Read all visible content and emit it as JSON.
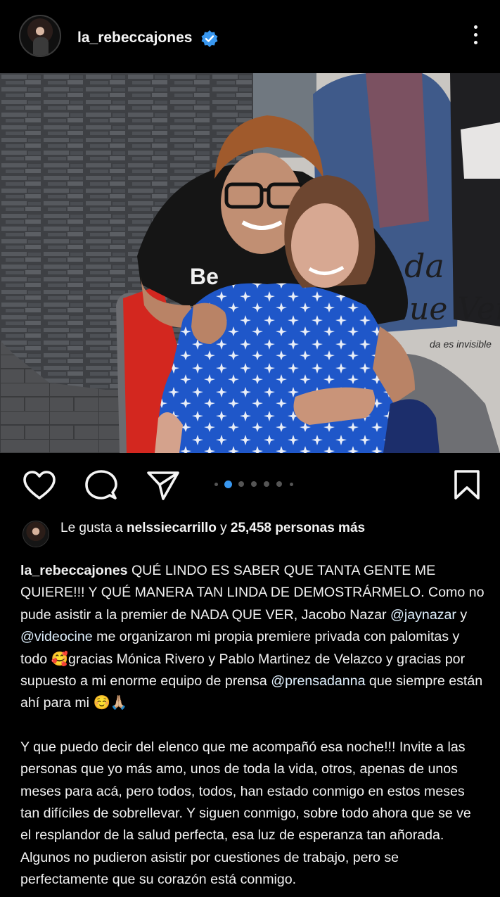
{
  "post": {
    "username": "la_rebeccajones",
    "verified_icon": "verified-badge-icon",
    "more_icon": "more-vertical-icon"
  },
  "actions": {
    "like_icon": "heart-icon",
    "comment_icon": "comment-icon",
    "share_icon": "send-icon",
    "save_icon": "bookmark-icon",
    "carousel_count": 6,
    "carousel_active": 1
  },
  "likes": {
    "prefix": "Le gusta a ",
    "user": "nelssiecarrillo",
    "middle": " y ",
    "count": "25,458 personas",
    "suffix": " más"
  },
  "caption": {
    "author": "la_rebeccajones",
    "p1a": " QUÉ LINDO ES SABER QUE TANTA GENTE ME QUIERE!!! Y QUÉ MANERA TAN LINDA DE DEMOSTRÁRMELO. Como no pude asistir a la premier de NADA QUE VER, Jacobo Nazar ",
    "m1": "@jaynazar",
    "p1b": " y ",
    "m2": "@videocine",
    "p1c": " me organizaron mi propia premiere privada con palomitas y todo 🥰gracias Mónica Rivero y Pablo Martinez de Velazco y gracias por supuesto a mi enorme equipo de prensa ",
    "m3": "@prensadanna",
    "p1d": " que siempre están ahí para mi ☺️🙏🏼",
    "p2": "Y que puedo decir del elenco que me acompañó esa noche!!! Invite a las personas que yo más amo, unos de toda la vida, otros, apenas de unos meses para acá, pero todos, todos, han estado conmigo en estos meses tan difíciles de sobrellevar. Y siguen conmigo, sobre todo ahora que se ve el resplandor de la salud perfecta, esa luz de esperanza tan añorada. Algunos no pudieron asistir por cuestiones de trabajo, pero se perfectamente que su corazón está conmigo."
  },
  "poster": {
    "title_line1": "da",
    "title_line2": "ue Ver",
    "tagline": "da es invisible"
  },
  "colors": {
    "background": "#000000",
    "text": "#f5f5f5",
    "verified": "#3897f0",
    "dot_active": "#3897f0",
    "dot_inactive": "#555555"
  }
}
